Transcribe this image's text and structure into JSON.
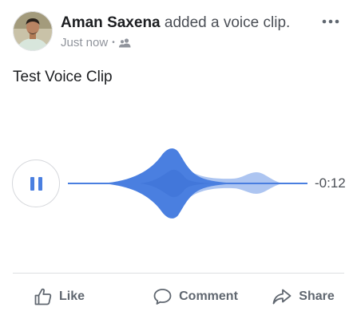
{
  "post": {
    "author": "Aman Saxena",
    "action_text": "added a voice clip.",
    "time": "Just now",
    "separator": "•",
    "audience_icon": "friends-icon",
    "more_icon": "more-options-icon",
    "caption": "Test Voice Clip"
  },
  "player": {
    "state": "playing",
    "control_icon": "pause-icon",
    "remaining_time": "-0:12",
    "accent_color": "#4a7fe0"
  },
  "actions": {
    "like": "Like",
    "comment": "Comment",
    "share": "Share"
  },
  "colors": {
    "text_primary": "#1c1e21",
    "text_secondary": "#90949c",
    "divider": "#dddfe2",
    "action_gray": "#606770"
  }
}
